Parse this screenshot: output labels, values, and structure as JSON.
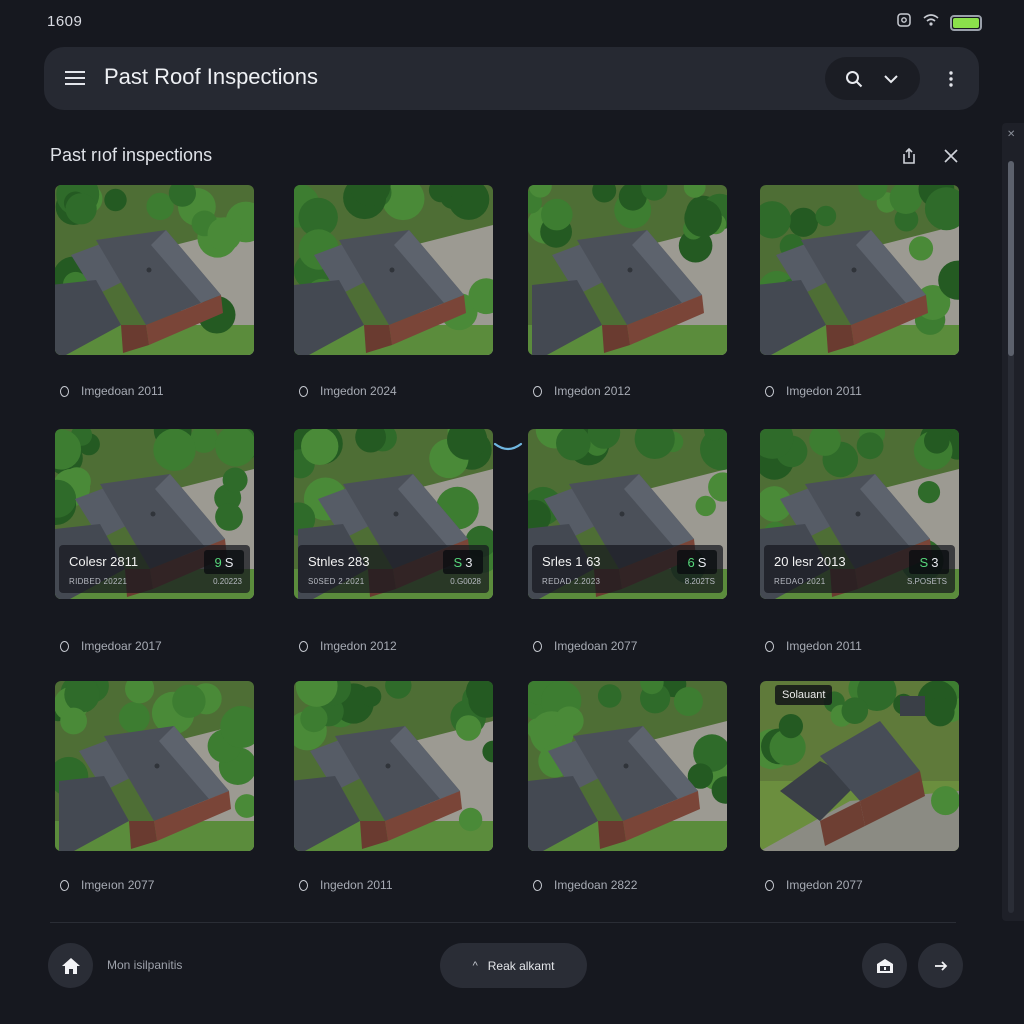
{
  "status_bar": {
    "time": "1609"
  },
  "app_bar": {
    "title": "Past Roof Inspections"
  },
  "section": {
    "title": "Past rıof inspections"
  },
  "grid": {
    "cards": [
      {
        "caption": "Imgedoan 2011"
      },
      {
        "caption": "Imgedon 2024"
      },
      {
        "caption": "Imgedon 2012"
      },
      {
        "caption": "Imgedon 2011"
      },
      {
        "caption": "Imgedoar 2017",
        "overlay": {
          "title": "Colesr 2811",
          "badge_a": "9",
          "badge_b": "S",
          "subtitle": "RIDBED 20221",
          "code": "0.20223"
        }
      },
      {
        "caption": "Imgedon 2012",
        "overlay": {
          "title": "Stnles 283",
          "badge_a": "S",
          "badge_b": "3",
          "subtitle": "S0SED 2.2021",
          "code": "0.G0028"
        }
      },
      {
        "caption": "Imgedoan 2077",
        "overlay": {
          "title": "Srles 1 63",
          "badge_a": "6",
          "badge_b": "S",
          "subtitle": "REDAD 2.2023",
          "code": "8.202TS"
        }
      },
      {
        "caption": "Imgedon 2011",
        "overlay": {
          "title": "20 lesr 2013",
          "badge_a": "S",
          "badge_b": "3",
          "subtitle": "REDAO 2021",
          "code": "S.POSETS"
        }
      },
      {
        "caption": "Imgeıon 2077"
      },
      {
        "caption": "Ingedon 2011"
      },
      {
        "caption": "Imgedoan 2822"
      },
      {
        "caption": "Imgedon 2077",
        "tag": "Solauant"
      }
    ]
  },
  "bottom_bar": {
    "label": "Mon isilpanitis",
    "action_label": "Reak alkamt",
    "action_caret": "^"
  },
  "colors": {
    "background": "#16181f",
    "surface": "#262932",
    "accent_green": "#56d67a",
    "battery": "#8be04b",
    "chevron_blue": "#6fb6e0"
  },
  "icons": [
    "menu-icon",
    "search-icon",
    "chevron-down-icon",
    "more-vert-icon",
    "share-icon",
    "close-icon",
    "home-icon",
    "garage-icon",
    "arrow-right-icon",
    "wifi-icon",
    "battery-icon",
    "cast-icon"
  ]
}
